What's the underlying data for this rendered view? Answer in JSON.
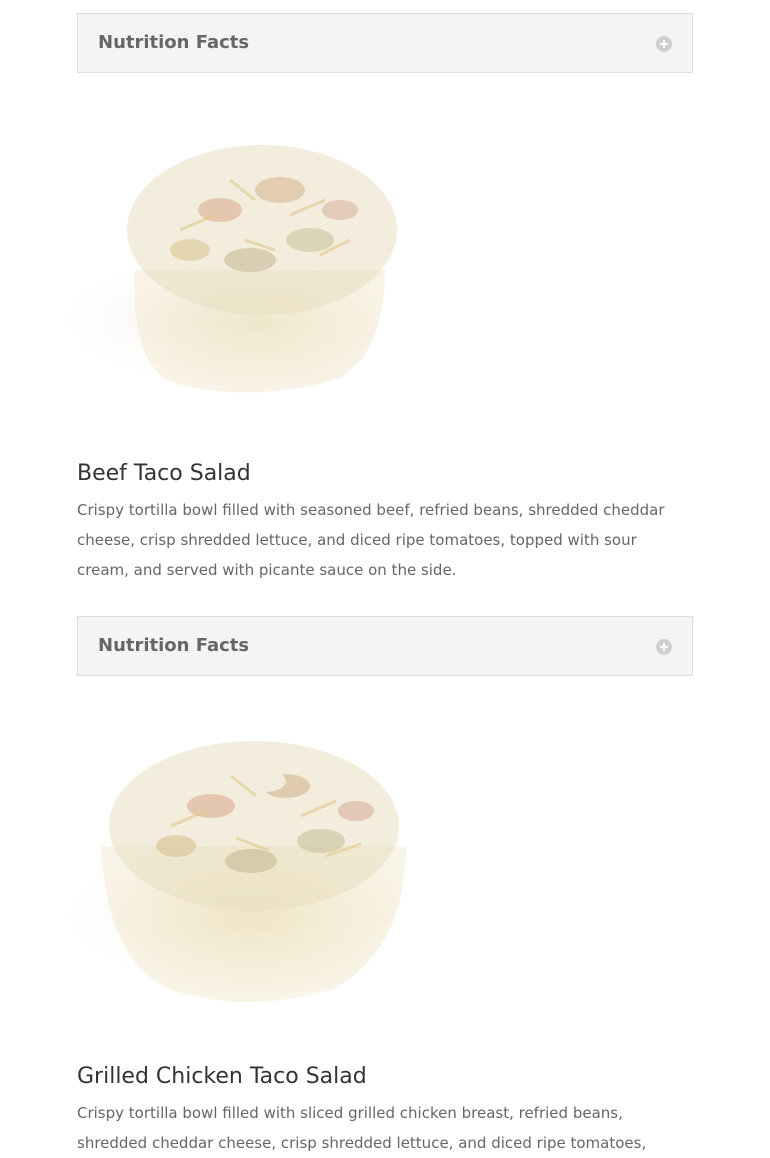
{
  "toggles": [
    {
      "title": "Nutrition Facts",
      "icon": "plus-circle-icon"
    },
    {
      "title": "Nutrition Facts",
      "icon": "plus-circle-icon"
    }
  ],
  "items": [
    {
      "image_alt": "taco-salad-image",
      "title": "Beef Taco Salad",
      "description": "Crispy tortilla bowl filled with seasoned beef, refried beans, shredded cheddar cheese, crisp shredded lettuce, and diced ripe tomatoes, topped with sour cream, and served with picante sauce on the side."
    },
    {
      "image_alt": "taco-salad-image",
      "title": "Grilled Chicken Taco Salad",
      "description": "Crispy tortilla bowl filled with sliced grilled chicken breast, refried beans, shredded cheddar cheese, crisp shredded lettuce, and diced ripe tomatoes,"
    }
  ],
  "colors": {
    "toggle_bg": "#f4f4f4",
    "toggle_border": "#dddddd",
    "title_text": "#333333",
    "body_text": "#666666"
  }
}
